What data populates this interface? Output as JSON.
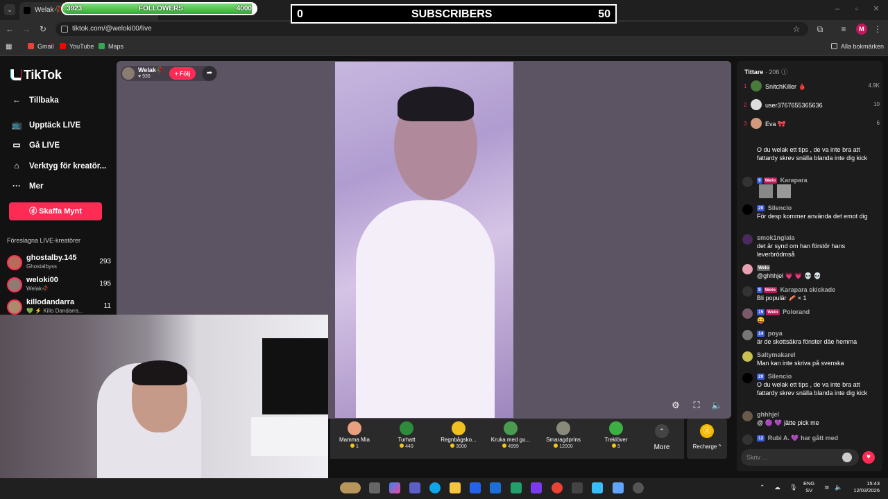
{
  "browser": {
    "tab_title": "Welak🥀 (@",
    "url": "tiktok.com/@weloki00/live",
    "profile_initial": "M",
    "bookmarks": [
      {
        "label": "Gmail",
        "color": "#ea4335"
      },
      {
        "label": "YouTube",
        "color": "#ff0000"
      },
      {
        "label": "Maps",
        "color": "#34a853"
      }
    ],
    "all_bookmarks": "Alla bokmärken"
  },
  "overlay": {
    "followers": {
      "current": "3923",
      "label": "FOLLOWERS",
      "goal": "4000",
      "progress": 0.98
    },
    "subscribers": {
      "current": "0",
      "label": "SUBSCRIBERS",
      "goal": "50"
    }
  },
  "sidebar": {
    "logo": "TikTok",
    "nav": [
      {
        "label": "Tillbaka",
        "icon": "back-arrow-icon"
      },
      {
        "label": "Upptäck LIVE",
        "icon": "live-tv-icon"
      },
      {
        "label": "Gå LIVE",
        "icon": "camera-icon"
      },
      {
        "label": "Verktyg för kreatör...",
        "icon": "play-tools-icon"
      },
      {
        "label": "Mer",
        "icon": "more-dots-icon"
      }
    ],
    "cta": "Skaffa Mynt",
    "suggested_title": "Föreslagna LIVE-kreatörer",
    "creators": [
      {
        "name": "ghostalby.145",
        "sub": "Ghostalbyss",
        "count": "293"
      },
      {
        "name": "weloki00",
        "sub": "Welak🥀",
        "count": "195"
      },
      {
        "name": "killodandarra",
        "sub": "💚 ⚡ Killo Dandarra...",
        "count": "11"
      }
    ]
  },
  "stream": {
    "host_name": "Welak🥀",
    "host_views": "936",
    "follow_label": "+ Följ"
  },
  "gifts": [
    {
      "name": "Mamma Mia",
      "price": "1",
      "color": "#e8a080"
    },
    {
      "name": "Turhatt",
      "price": "449",
      "color": "#2e8b3a"
    },
    {
      "name": "Regnbågsko...",
      "price": "3000",
      "color": "#f0c020"
    },
    {
      "name": "Kruka med gu...",
      "price": "4999",
      "color": "#4a9a50"
    },
    {
      "name": "Smaragdprins",
      "price": "12000",
      "color": "#8a8a7a"
    },
    {
      "name": "Treklöver",
      "price": "5",
      "color": "#3cb043"
    }
  ],
  "more_label": "More",
  "recharge_label": "Recharge ^",
  "chat": {
    "viewers_label": "Tittare",
    "viewers_count": "· 206",
    "top_viewers": [
      {
        "rank": "1",
        "name": "SnitchKiller 🩸",
        "score": "4.9K"
      },
      {
        "rank": "2",
        "name": "user3767655365636",
        "score": "10"
      },
      {
        "rank": "3",
        "name": "Eva 🎀",
        "score": "6"
      }
    ],
    "messages": [
      {
        "user": "",
        "badges": [],
        "text": "O du welak ett tips , de va inte bra att fattardy skrev snälla blanda inte dig kick"
      },
      {
        "user": "Karapara",
        "badges": [
          "9",
          "Welo"
        ],
        "text": ""
      },
      {
        "user": "Silencio",
        "badges": [
          "20"
        ],
        "text": "För desp kommer använda det emot dig"
      },
      {
        "user": "smok1nglala",
        "badges": [],
        "text": "det är synd om han förstör hans leverbrödmså"
      },
      {
        "user": "",
        "badges": [
          "Welo"
        ],
        "text": "@ghhhjel 💗 💗 💀 💀"
      },
      {
        "user": "Karapara skickade",
        "badges": [
          "9",
          "Welo"
        ],
        "text": "Bli populär 🥓 × 1"
      },
      {
        "user": "Polorand",
        "badges": [
          "15",
          "Welo"
        ],
        "text": "😝"
      },
      {
        "user": "poya",
        "badges": [
          "14"
        ],
        "text": "är de skottsäkra fönster däe hemma"
      },
      {
        "user": "Saltymakarel",
        "badges": [],
        "text": "Man kan inte skriva på svenska"
      },
      {
        "user": "Silencio",
        "badges": [
          "20"
        ],
        "text": "O du welak ett tips , de va inte bra att fattardy skrev snälla blanda inte dig kick"
      },
      {
        "user": "ghhhjel",
        "badges": [],
        "text": "@ 🟣 💜 jätte pick me"
      },
      {
        "user": "Rubi A. 💜 har gått med",
        "badges": [
          "12"
        ],
        "text": ""
      }
    ],
    "input_placeholder": "Skriv ..."
  },
  "taskbar": {
    "lang": "ENG",
    "region": "SV",
    "time": "15:43",
    "date": "12/03/2026"
  }
}
